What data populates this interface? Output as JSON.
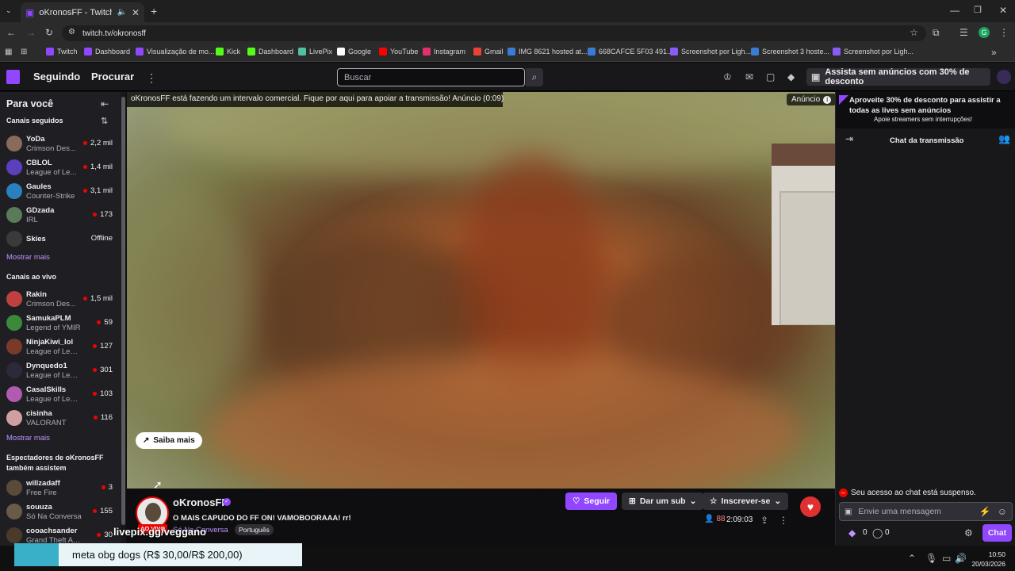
{
  "browser": {
    "tab_title": "oKronosFF - Twitch",
    "url": "twitch.tv/okronosff",
    "bookmarks": [
      {
        "label": "Twitch",
        "color": "#9146ff"
      },
      {
        "label": "Dashboard",
        "color": "#9146ff"
      },
      {
        "label": "Visualização de mo...",
        "color": "#9146ff"
      },
      {
        "label": "Kick",
        "color": "#53fc18"
      },
      {
        "label": "Dashboard",
        "color": "#53fc18"
      },
      {
        "label": "LivePix",
        "color": "#4fc3a1"
      },
      {
        "label": "Google",
        "color": "#ffffff"
      },
      {
        "label": "YouTube",
        "color": "#ff0000"
      },
      {
        "label": "Instagram",
        "color": "#e1306c"
      },
      {
        "label": "Gmail",
        "color": "#ea4335"
      },
      {
        "label": "IMG 8621 hosted at...",
        "color": "#3a7bd5"
      },
      {
        "label": "668CAFCE 5F03 491...",
        "color": "#3a7bd5"
      },
      {
        "label": "Screenshot por Ligh...",
        "color": "#8a5cf6"
      },
      {
        "label": "Screenshot 3 hoste...",
        "color": "#3a7bd5"
      },
      {
        "label": "Screenshot por Ligh...",
        "color": "#8a5cf6"
      }
    ]
  },
  "topnav": {
    "following": "Seguindo",
    "browse": "Procurar",
    "search_placeholder": "Buscar",
    "promo": "Assista sem anúncios com 30% de desconto"
  },
  "sidebar": {
    "for_you": "Para você",
    "followed_title": "Canais seguidos",
    "followed": [
      {
        "name": "YoDa",
        "game": "Crimson Des...",
        "viewers": "2,2 mil",
        "color": "#8a6a5a"
      },
      {
        "name": "CBLOL",
        "game": "League of Le...",
        "viewers": "1,4 mil",
        "color": "#5b3fbf"
      },
      {
        "name": "Gaules",
        "game": "Counter-Strike",
        "viewers": "3,1 mil",
        "color": "#2a7fbf"
      },
      {
        "name": "GDzada",
        "game": "IRL",
        "viewers": "173",
        "color": "#5a7a5a"
      },
      {
        "name": "Skies",
        "game": "",
        "viewers": "Offline",
        "color": "#3a3a3a"
      }
    ],
    "show_more": "Mostrar mais",
    "live_title": "Canais ao vivo",
    "live": [
      {
        "name": "Rakin",
        "game": "Crimson Des...",
        "viewers": "1,5 mil",
        "color": "#c04040"
      },
      {
        "name": "SamukaPLM",
        "game": "Legend of YMIR",
        "viewers": "59",
        "color": "#3a8a3a"
      },
      {
        "name": "NinjaKiwi_lol",
        "game": "League of Lege...",
        "viewers": "127",
        "color": "#7a3a2a"
      },
      {
        "name": "Dynquedo1",
        "game": "League of Lege...",
        "viewers": "301",
        "color": "#2a2a3a"
      },
      {
        "name": "CasalSkills",
        "game": "League of Lege...",
        "viewers": "103",
        "color": "#b05ab0"
      },
      {
        "name": "cisinha",
        "game": "VALORANT",
        "viewers": "116",
        "color": "#d0a0a0"
      }
    ],
    "show_more2": "Mostrar mais",
    "also_title_1": "Espectadores de oKronosFF",
    "also_title_2": "também assistem",
    "also": [
      {
        "name": "willzadaff",
        "game": "Free Fire",
        "viewers": "3",
        "color": "#5a4a3a"
      },
      {
        "name": "souuza",
        "game": "Só Na Conversa",
        "viewers": "155",
        "color": "#6a5a4a"
      },
      {
        "name": "cooachsander",
        "game": "Grand Theft Au...",
        "viewers": "30",
        "color": "#4a3a2a"
      }
    ]
  },
  "player": {
    "ad_text": "oKronosFF está fazendo um intervalo comercial. Fique por aqui para apoiar a transmissão! Anúncio (0:09)",
    "ad_label": "Anúncio",
    "learn_more": "Saiba mais"
  },
  "stream": {
    "channel": "oKronosFF",
    "title": "O MAIS CAPUDO DO FF ON! VAMOBOORAAA! rr!",
    "category": "Só Na Conversa",
    "tag": "Português",
    "live_badge": "AO VIVO",
    "follow": "Seguir",
    "gift_sub": "Dar um sub",
    "subscribe": "Inscrever-se",
    "viewers": "88",
    "uptime": "2:09:03"
  },
  "chat": {
    "promo_line1": "Aproveite 30% de desconto para assistir a",
    "promo_line2": "todas as lives sem anúncios",
    "promo_sub": "Apoie streamers sem interrupções!",
    "header": "Chat da transmissão",
    "suspended": "Seu acesso ao chat está suspenso.",
    "input_placeholder": "Envie uma mensagem",
    "bits": "0",
    "points": "0",
    "chat_button": "Chat"
  },
  "overlay": {
    "donation_link": "livepix.gg/veggano",
    "goal": "meta obg dogs (R$ 30,00/R$ 200,00)"
  },
  "taskbar": {
    "time": "10:50",
    "date": "20/03/2026"
  },
  "colors": {
    "accent": "#9146ff",
    "live": "#eb0400",
    "bg": "#0e0e10"
  }
}
